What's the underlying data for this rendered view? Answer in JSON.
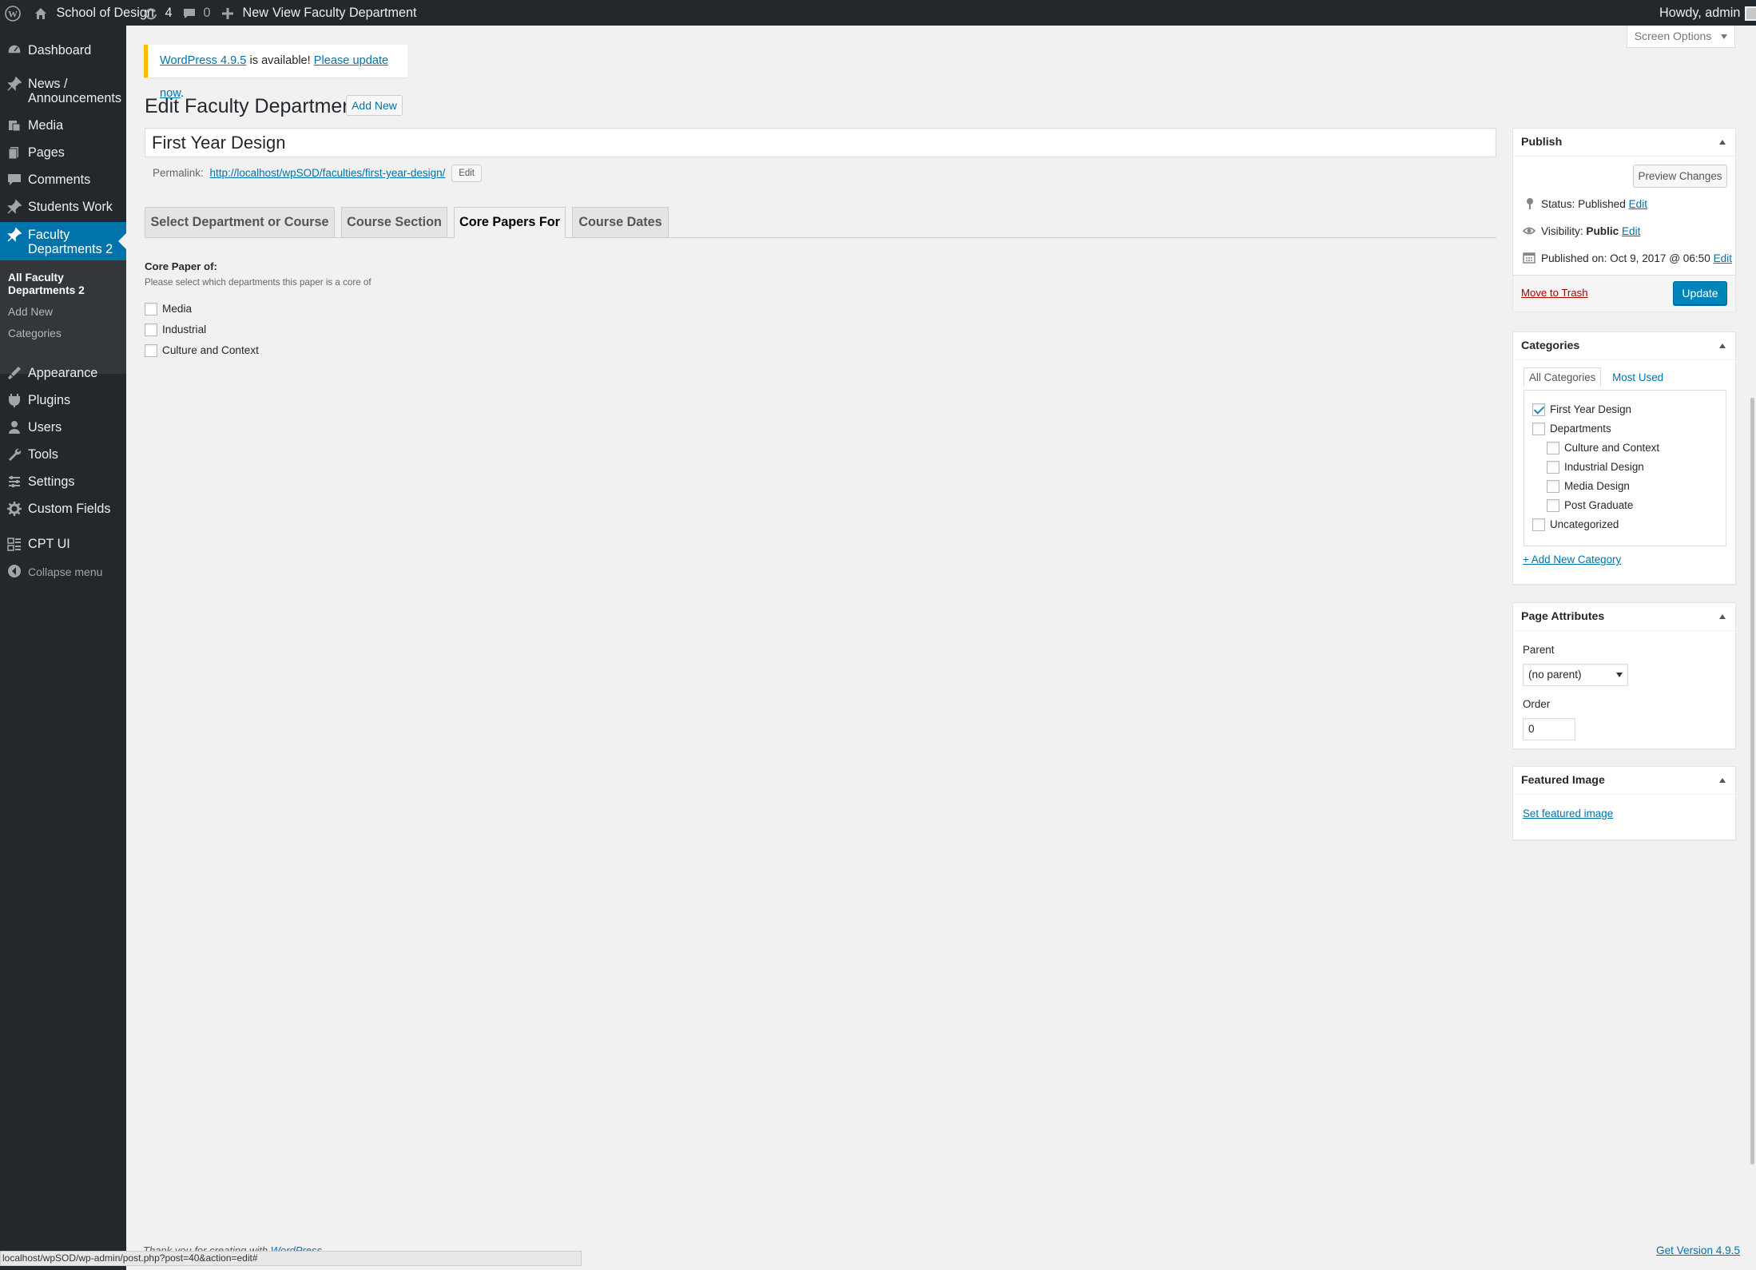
{
  "adminbar": {
    "site_name": "School of Design",
    "updates_count": "4",
    "comments_count": "0",
    "new_label": "New",
    "view_label": "View Faculty Department",
    "howdy": "Howdy, admin"
  },
  "sidebar": {
    "items": [
      {
        "label": "Dashboard",
        "icon": "dashboard-icon"
      },
      {
        "label": "News /",
        "label2": "Announcements",
        "icon": "pin-icon"
      },
      {
        "label": "Media",
        "icon": "media-icon"
      },
      {
        "label": "Pages",
        "icon": "pages-icon"
      },
      {
        "label": "Comments",
        "icon": "comments-icon"
      },
      {
        "label": "Students Work",
        "icon": "pin-icon"
      },
      {
        "label": "Faculty",
        "label2": "Departments 2",
        "icon": "pin-icon"
      },
      {
        "label": "Appearance",
        "icon": "appearance-icon"
      },
      {
        "label": "Plugins",
        "icon": "plugins-icon"
      },
      {
        "label": "Users",
        "icon": "users-icon"
      },
      {
        "label": "Tools",
        "icon": "tools-icon"
      },
      {
        "label": "Settings",
        "icon": "settings-icon"
      },
      {
        "label": "Custom Fields",
        "icon": "custom-fields-icon"
      },
      {
        "label": "CPT UI",
        "icon": "cpt-ui-icon"
      },
      {
        "label": "Collapse menu",
        "icon": "collapse-icon"
      }
    ],
    "submenu": [
      {
        "label": "All Faculty",
        "label2": "Departments 2"
      },
      {
        "label": "Add New"
      },
      {
        "label": "Categories"
      }
    ]
  },
  "notice": {
    "link1": "WordPress 4.9.5",
    "middle": " is available! ",
    "link2": "Please update now",
    "end": "."
  },
  "screen_options": "Screen Options",
  "page": {
    "title": "Edit Faculty Department",
    "add_new": "Add New",
    "post_title": "First Year Design",
    "permalink_label": "Permalink:",
    "permalink_url": "http://localhost/wpSOD/faculties/first-year-design/",
    "permalink_edit": "Edit"
  },
  "tabs": [
    {
      "label": "Select Department or Course",
      "active": false
    },
    {
      "label": "Course Section",
      "active": false
    },
    {
      "label": "Core Papers For",
      "active": true
    },
    {
      "label": "Course Dates",
      "active": false
    }
  ],
  "core_papers": {
    "label": "Core Paper of:",
    "description": "Please select which departments this paper is a core of",
    "options": [
      {
        "label": "Media",
        "checked": false
      },
      {
        "label": "Industrial",
        "checked": false
      },
      {
        "label": "Culture and Context",
        "checked": false
      }
    ]
  },
  "publish": {
    "title": "Publish",
    "preview": "Preview Changes",
    "status_label": "Status: ",
    "status_value": "Published",
    "visibility_label": "Visibility: ",
    "visibility_value": "Public",
    "published_label": "Published on: ",
    "published_value": "Oct 9, 2017 @ 06:50",
    "edit": "Edit",
    "trash": "Move to Trash",
    "update": "Update"
  },
  "categories": {
    "title": "Categories",
    "tab_all": "All Categories",
    "tab_most_used": "Most Used",
    "items": [
      {
        "label": "First Year Design",
        "checked": true,
        "level": 0
      },
      {
        "label": "Departments",
        "checked": false,
        "level": 0
      },
      {
        "label": "Culture and Context",
        "checked": false,
        "level": 1
      },
      {
        "label": "Industrial Design",
        "checked": false,
        "level": 1
      },
      {
        "label": "Media Design",
        "checked": false,
        "level": 1
      },
      {
        "label": "Post Graduate",
        "checked": false,
        "level": 1
      },
      {
        "label": "Uncategorized",
        "checked": false,
        "level": 0
      }
    ],
    "add_new": "+ Add New Category"
  },
  "page_attributes": {
    "title": "Page Attributes",
    "parent_label": "Parent",
    "parent_value": "(no parent)",
    "order_label": "Order",
    "order_value": "0"
  },
  "featured_image": {
    "title": "Featured Image",
    "link": "Set featured image"
  },
  "footer": {
    "thanks": "Thank you for creating with ",
    "wordpress": "WordPress",
    "thanks_end": ".",
    "version": "Get Version 4.9.5"
  },
  "statusbar": "localhost/wpSOD/wp-admin/post.php?post=40&action=edit#",
  "colors": {
    "adminbar_bg": "#23282d",
    "accent": "#0073aa",
    "primary_button": "#0085ba",
    "notice_border": "#ffb900",
    "delete": "#a00"
  }
}
